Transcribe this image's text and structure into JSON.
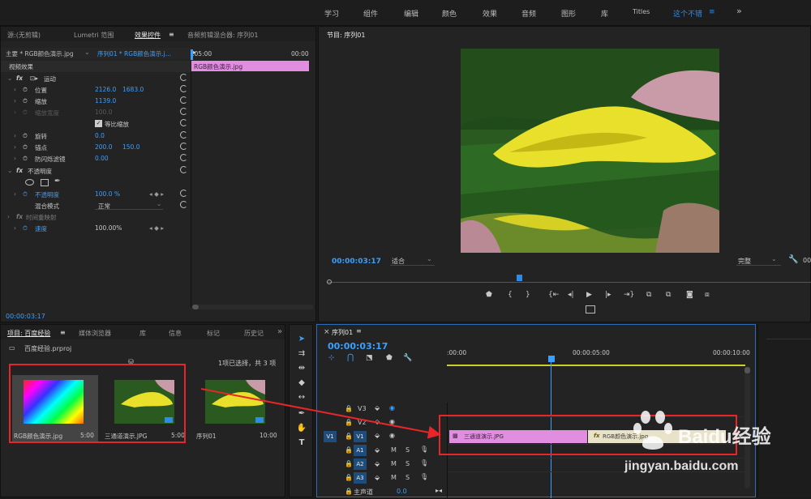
{
  "workspaces": [
    "学习",
    "组件",
    "编辑",
    "颜色",
    "效果",
    "音频",
    "图形",
    "库",
    "Titles",
    "这个不错"
  ],
  "workspace_menu_glyph": "≡",
  "workspace_more": "»",
  "effect_controls": {
    "tabs": [
      "源:(无剪辑)",
      "Lumetri 范围",
      "效果控件",
      "音频剪辑混合器: 序列01"
    ],
    "tab_menu_glyph": "≡",
    "master_label": "主要 * RGB颜色演示.jpg",
    "sequence_label": "序列01 * RGB颜色演示.j...",
    "play_glyph": "▸",
    "time_start": ":05:00",
    "time_end": "00:00",
    "clip_label": "RGB颜色演示.jpg",
    "section_video": "视频效果",
    "fx_label": "fx",
    "rows": {
      "motion": "运动",
      "position": "位置",
      "position_x": "2126.0",
      "position_y": "1683.0",
      "scale": "缩放",
      "scale_val": "1139.0",
      "scale_width": "缩放宽度",
      "scale_width_val": "100.0",
      "uniform": "等比缩放",
      "rotation": "旋转",
      "rotation_val": "0.0",
      "anchor": "锚点",
      "anchor_x": "200.0",
      "anchor_y": "150.0",
      "flicker": "防闪烁滤镜",
      "flicker_val": "0.00",
      "opacity_group": "不透明度",
      "opacity": "不透明度",
      "opacity_val": "100.0 %",
      "blend": "混合模式",
      "blend_val": "正常",
      "remap": "时间重映射",
      "speed": "速度",
      "speed_val": "100.00%"
    },
    "timecode": "00:00:03:17"
  },
  "program": {
    "title": "节目: 序列01",
    "timecode": "00:00:03:17",
    "fit": "适合",
    "quality": "完整",
    "timecode_right": "00"
  },
  "project": {
    "tabs": [
      "项目: 百度经验",
      "媒体浏览器",
      "库",
      "信息",
      "标记",
      "历史记"
    ],
    "more": "»",
    "file": "百度经验.prproj",
    "selection": "1项已选择，共 3 项",
    "items": [
      {
        "name": "RGB颜色演示.jpg",
        "duration": "5:00"
      },
      {
        "name": "三通道演示.JPG",
        "duration": "5:00"
      },
      {
        "name": "序列01",
        "duration": "10:00"
      }
    ]
  },
  "timeline": {
    "title": "序列01",
    "timecode": "00:00:03:17",
    "ruler": [
      ":00:00",
      "00:00:05:00",
      "00:00:10:00"
    ],
    "tracks": [
      "V3",
      "V2",
      "V1",
      "A1",
      "A2",
      "A3"
    ],
    "source_v1": "V1",
    "master": "主声道",
    "master_val": "0.0",
    "track_letters": {
      "m": "M",
      "s": "S"
    },
    "clips": [
      "三通道演示.JPG",
      "RGB颜色演示.jpg"
    ]
  },
  "watermark": {
    "brand": "Baidu经验",
    "url": "jingyan.baidu.com"
  },
  "colors": {
    "accent": "#2d8ceb",
    "clip": "#e18ee1",
    "annotation": "#e8262a",
    "timecode": "#3aa0ff"
  }
}
